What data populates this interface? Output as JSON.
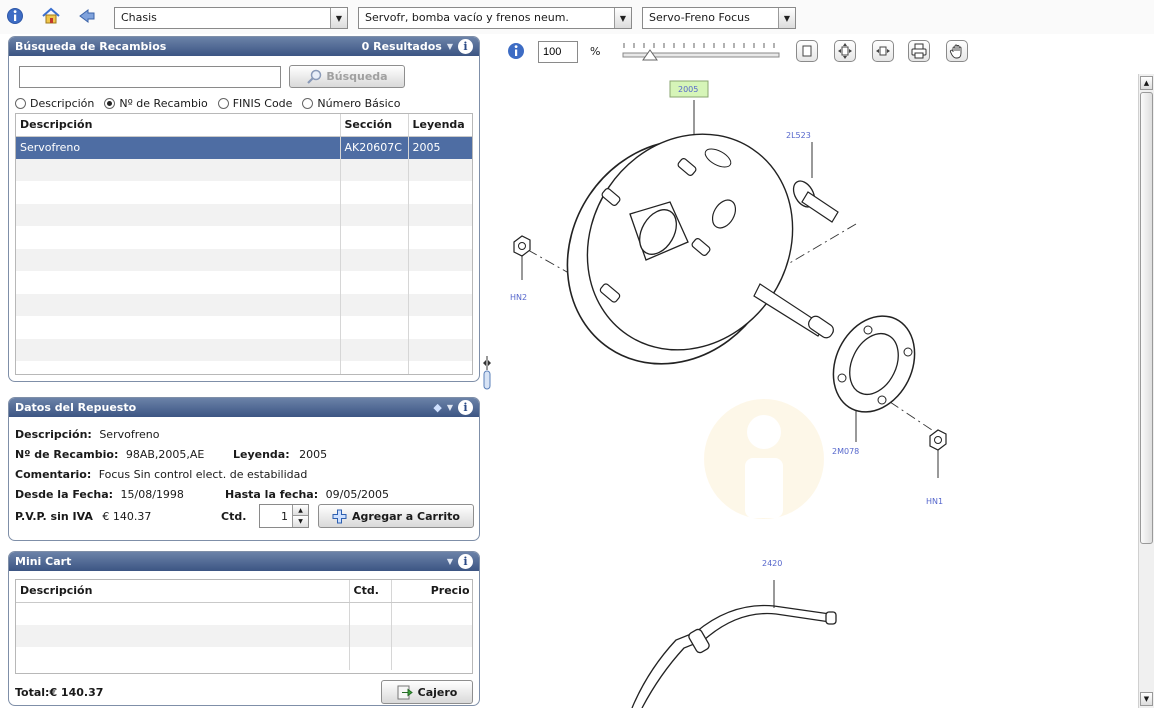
{
  "toolbar": {
    "selects": [
      {
        "value": "Chasis"
      },
      {
        "value": "Servofr, bomba vacío y frenos neum."
      },
      {
        "value": "Servo-Freno Focus"
      }
    ]
  },
  "search_panel": {
    "title": "Búsqueda de Recambios",
    "results": "0 Resultados",
    "search_value": "",
    "search_button": "Búsqueda",
    "radios": [
      {
        "label": "Descripción",
        "checked": false
      },
      {
        "label": "Nº de Recambio",
        "checked": true
      },
      {
        "label": "FINIS Code",
        "checked": false
      },
      {
        "label": "Número Básico",
        "checked": false
      }
    ],
    "columns": [
      "Descripción",
      "Sección",
      "Leyenda"
    ],
    "rows": [
      {
        "descripcion": "Servofreno",
        "seccion": "AK20607C",
        "leyenda": "2005",
        "selected": true
      }
    ]
  },
  "detail_panel": {
    "title": "Datos del Repuesto",
    "descripcion_label": "Descripción:",
    "descripcion_value": "Servofreno",
    "recambio_label": "Nº de Recambio:",
    "recambio_value": "98AB,2005,AE",
    "leyenda_label": "Leyenda:",
    "leyenda_value": "2005",
    "comentario_label": "Comentario:",
    "comentario_value": "Focus Sin control elect. de estabilidad",
    "desde_label": "Desde la Fecha:",
    "desde_value": "15/08/1998",
    "hasta_label": "Hasta la fecha:",
    "hasta_value": "09/05/2005",
    "pvp_label": "P.V.P. sin IVA",
    "pvp_value": "€ 140.37",
    "qty_label": "Ctd.",
    "qty_value": "1",
    "add_button": "Agregar a Carrito"
  },
  "cart_panel": {
    "title": "Mini Cart",
    "columns": [
      "Descripción",
      "Ctd.",
      "Precio"
    ],
    "total": "Total:€ 140.37",
    "checkout_button": "Cajero"
  },
  "viewer": {
    "zoom_value": "100",
    "zoom_unit": "%",
    "callouts": [
      "2005",
      "2L523",
      "HN2",
      "2M078",
      "HN1",
      "2420"
    ]
  },
  "colors": {
    "panel_header": "#3c5583",
    "selection": "#4e6da3",
    "callout_text": "#5566cc",
    "callout_highlight": "#d6f5b8"
  }
}
